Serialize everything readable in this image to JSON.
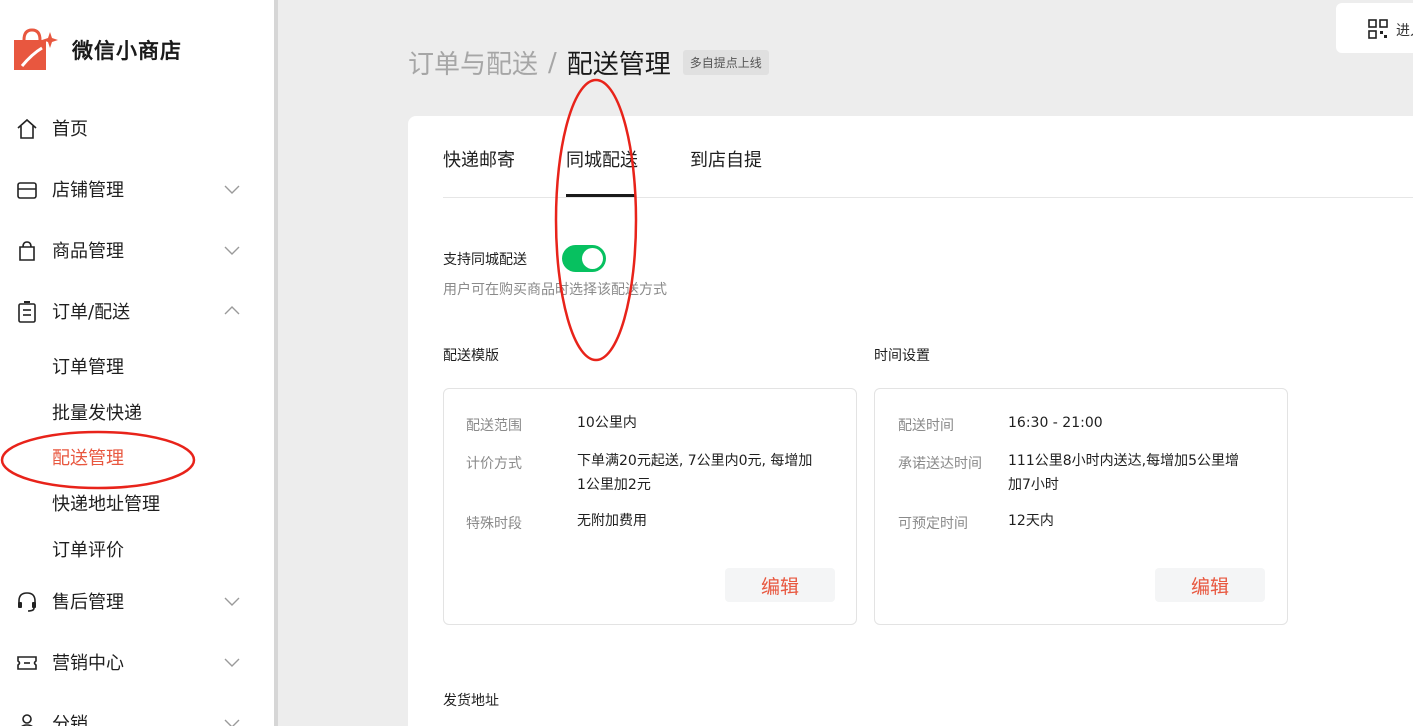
{
  "app": {
    "name": "微信小商店"
  },
  "sidebar": {
    "items": [
      {
        "label": "首页",
        "icon": "home-icon"
      },
      {
        "label": "店铺管理",
        "icon": "store-icon"
      },
      {
        "label": "商品管理",
        "icon": "bag-icon"
      },
      {
        "label": "订单/配送",
        "icon": "clipboard-icon"
      },
      {
        "label": "售后管理",
        "icon": "headset-icon"
      },
      {
        "label": "营销中心",
        "icon": "ticket-icon"
      },
      {
        "label": "分销",
        "icon": "person-icon"
      }
    ],
    "sub_items": [
      "订单管理",
      "批量发快递",
      "配送管理",
      "快递地址管理",
      "订单评价"
    ]
  },
  "header": {
    "breadcrumb_parent": "订单与配送",
    "breadcrumb_sep": "/",
    "breadcrumb_current": "配送管理",
    "tag": "多自提点上线",
    "top_button_label": "进入"
  },
  "tabs": [
    "快递邮寄",
    "同城配送",
    "到店自提"
  ],
  "active_tab": "同城配送",
  "support": {
    "label": "支持同城配送",
    "enabled": true,
    "desc": "用户可在购买商品时选择该配送方式"
  },
  "template": {
    "title": "配送模版",
    "rows": [
      {
        "k": "配送范围",
        "v": "10公里内"
      },
      {
        "k": "计价方式",
        "v1": "下单满20元起送, 7公里内0元, 每增加",
        "v2": "1公里加2元"
      },
      {
        "k": "特殊时段",
        "v": "无附加费用"
      }
    ],
    "edit": "编辑"
  },
  "time": {
    "title": "时间设置",
    "rows": [
      {
        "k": "配送时间",
        "v": "16:30 - 21:00"
      },
      {
        "k": "承诺送达时间",
        "v1": "111公里8小时内送达,每增加5公里增",
        "v2": "加7小时"
      },
      {
        "k": "可预定时间",
        "v": "12天内"
      }
    ],
    "edit": "编辑"
  },
  "ship_address_title": "发货地址",
  "colors": {
    "accent": "#e8573f",
    "toggle_on": "#07c160",
    "annotation": "#e8231a"
  }
}
